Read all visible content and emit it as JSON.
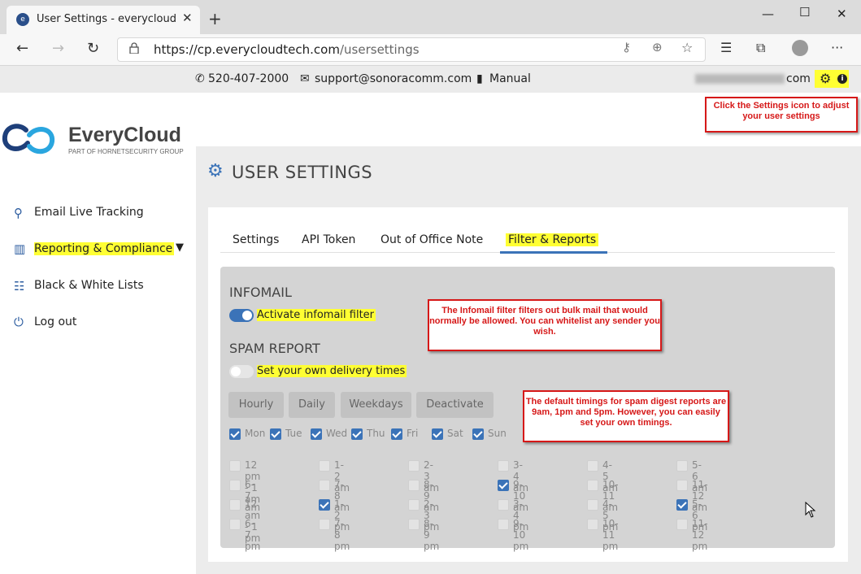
{
  "browser": {
    "tab_title": "User Settings - everycloud",
    "tab_icon": "everycloud-favicon",
    "url_host": "https://cp.everycloudtech.com",
    "url_path": "/usersettings",
    "window_buttons": [
      "minimize",
      "maximize",
      "close"
    ]
  },
  "infobar": {
    "phone": "520-407-2000",
    "email": "support@sonoracomm.com",
    "manual": "Manual",
    "user_email_suffix": "com"
  },
  "annotations": {
    "settings_note": "Click the Settings icon to adjust your user settings",
    "infomail_note": "The Infomail filter filters out bulk mail that would normally be allowed.  You can whitelist any sender you wish.",
    "timing_note": "The default timings for spam digest reports are 9am, 1pm and 5pm.  However, you can easily set your own timings."
  },
  "logo": {
    "name": "EveryCloud",
    "tagline": "PART OF HORNETSECURITY GROUP"
  },
  "sidebar": {
    "items": [
      {
        "label": "Email Live Tracking",
        "icon": "search-icon"
      },
      {
        "label": "Reporting & Compliance",
        "icon": "bar-chart-icon"
      },
      {
        "label": "Black & White Lists",
        "icon": "list-icon"
      },
      {
        "label": "Log out",
        "icon": "power-icon"
      }
    ]
  },
  "page": {
    "title": "USER SETTINGS",
    "tabs": [
      "Settings",
      "API Token",
      "Out of Office Note",
      "Filter & Reports"
    ],
    "active_tab": "Filter & Reports"
  },
  "infomail": {
    "heading": "INFOMAIL",
    "toggle_label": "Activate infomail filter",
    "enabled": true
  },
  "spam_report": {
    "heading": "SPAM REPORT",
    "toggle_label": "Set your own delivery times",
    "enabled": false,
    "presets": [
      "Hourly",
      "Daily",
      "Weekdays",
      "Deactivate"
    ],
    "days": [
      {
        "label": "Mon",
        "checked": true
      },
      {
        "label": "Tue",
        "checked": true
      },
      {
        "label": "Wed",
        "checked": true
      },
      {
        "label": "Thu",
        "checked": true
      },
      {
        "label": "Fri",
        "checked": true
      },
      {
        "label": "Sat",
        "checked": true
      },
      {
        "label": "Sun",
        "checked": true
      }
    ],
    "times": [
      {
        "label": "12 pm - 1 am",
        "checked": false
      },
      {
        "label": "1-2 am",
        "checked": false
      },
      {
        "label": "2-3 am",
        "checked": false
      },
      {
        "label": "3-4 am",
        "checked": false
      },
      {
        "label": "4-5 am",
        "checked": false
      },
      {
        "label": "5-6 am",
        "checked": false
      },
      {
        "label": "6-7 am",
        "checked": false
      },
      {
        "label": "7-8 am",
        "checked": false
      },
      {
        "label": "8-9 am",
        "checked": false
      },
      {
        "label": "9-10 am",
        "checked": true
      },
      {
        "label": "10-11 am",
        "checked": false
      },
      {
        "label": "11-12 am",
        "checked": false
      },
      {
        "label": "12 am - 1 pm",
        "checked": false
      },
      {
        "label": "1-2 pm",
        "checked": true
      },
      {
        "label": "2-3 pm",
        "checked": false
      },
      {
        "label": "3-4 pm",
        "checked": false
      },
      {
        "label": "4-5 pm",
        "checked": false
      },
      {
        "label": "5-6 pm",
        "checked": true
      },
      {
        "label": "6-7 pm",
        "checked": false
      },
      {
        "label": "7-8 pm",
        "checked": false
      },
      {
        "label": "8-9 pm",
        "checked": false
      },
      {
        "label": "9-10 pm",
        "checked": false
      },
      {
        "label": "10-11 pm",
        "checked": false
      },
      {
        "label": "11-12 pm",
        "checked": false
      }
    ]
  },
  "colors": {
    "accent": "#3b73b8",
    "highlight": "#ffff33",
    "annotation": "#d61818"
  }
}
